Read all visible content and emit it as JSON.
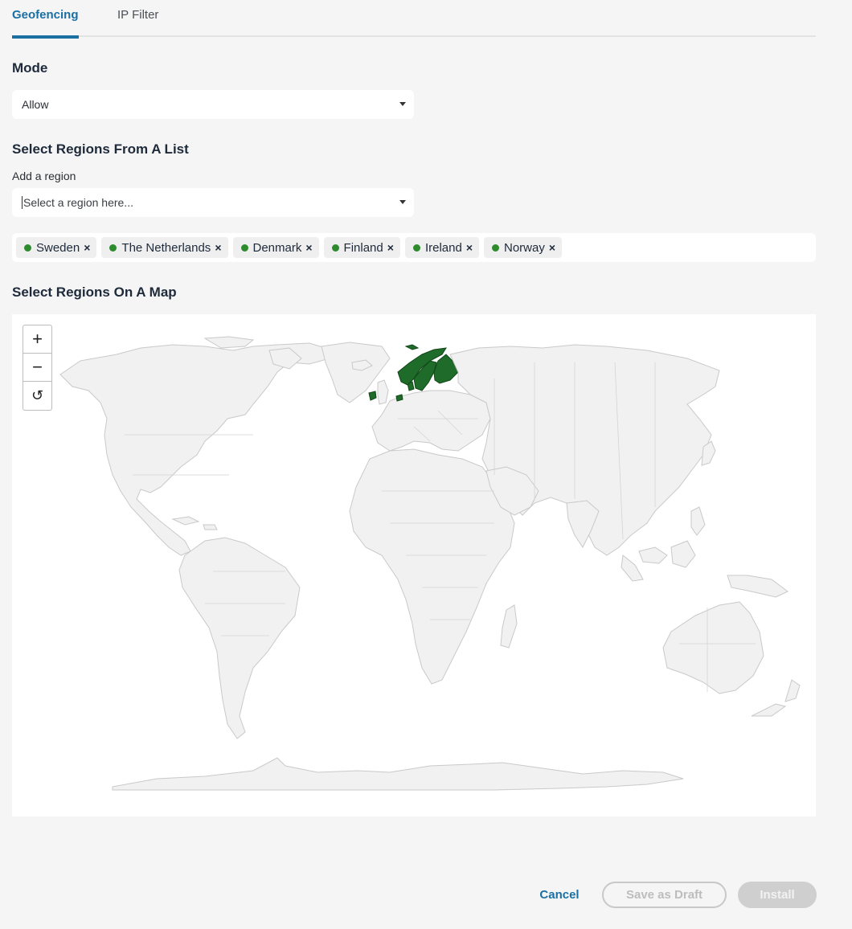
{
  "tabs": [
    {
      "label": "Geofencing",
      "active": true
    },
    {
      "label": "IP Filter",
      "active": false
    }
  ],
  "mode": {
    "heading": "Mode",
    "selected": "Allow"
  },
  "regions_list": {
    "heading": "Select Regions From A List",
    "add_label": "Add a region",
    "placeholder": "Select a region here...",
    "selected": [
      "Sweden",
      "The Netherlands",
      "Denmark",
      "Finland",
      "Ireland",
      "Norway"
    ],
    "chip_dot_color": "#2d8a2d"
  },
  "map": {
    "heading": "Select Regions On A Map",
    "zoom_in": "+",
    "zoom_out": "−",
    "reset": "↺",
    "selected_color": "#1e6b2a",
    "land_color": "#f1f1f1"
  },
  "footer": {
    "cancel": "Cancel",
    "save_draft": "Save as Draft",
    "install": "Install"
  },
  "colors": {
    "accent": "#1a6fa3",
    "disabled": "#cfcfcf"
  }
}
